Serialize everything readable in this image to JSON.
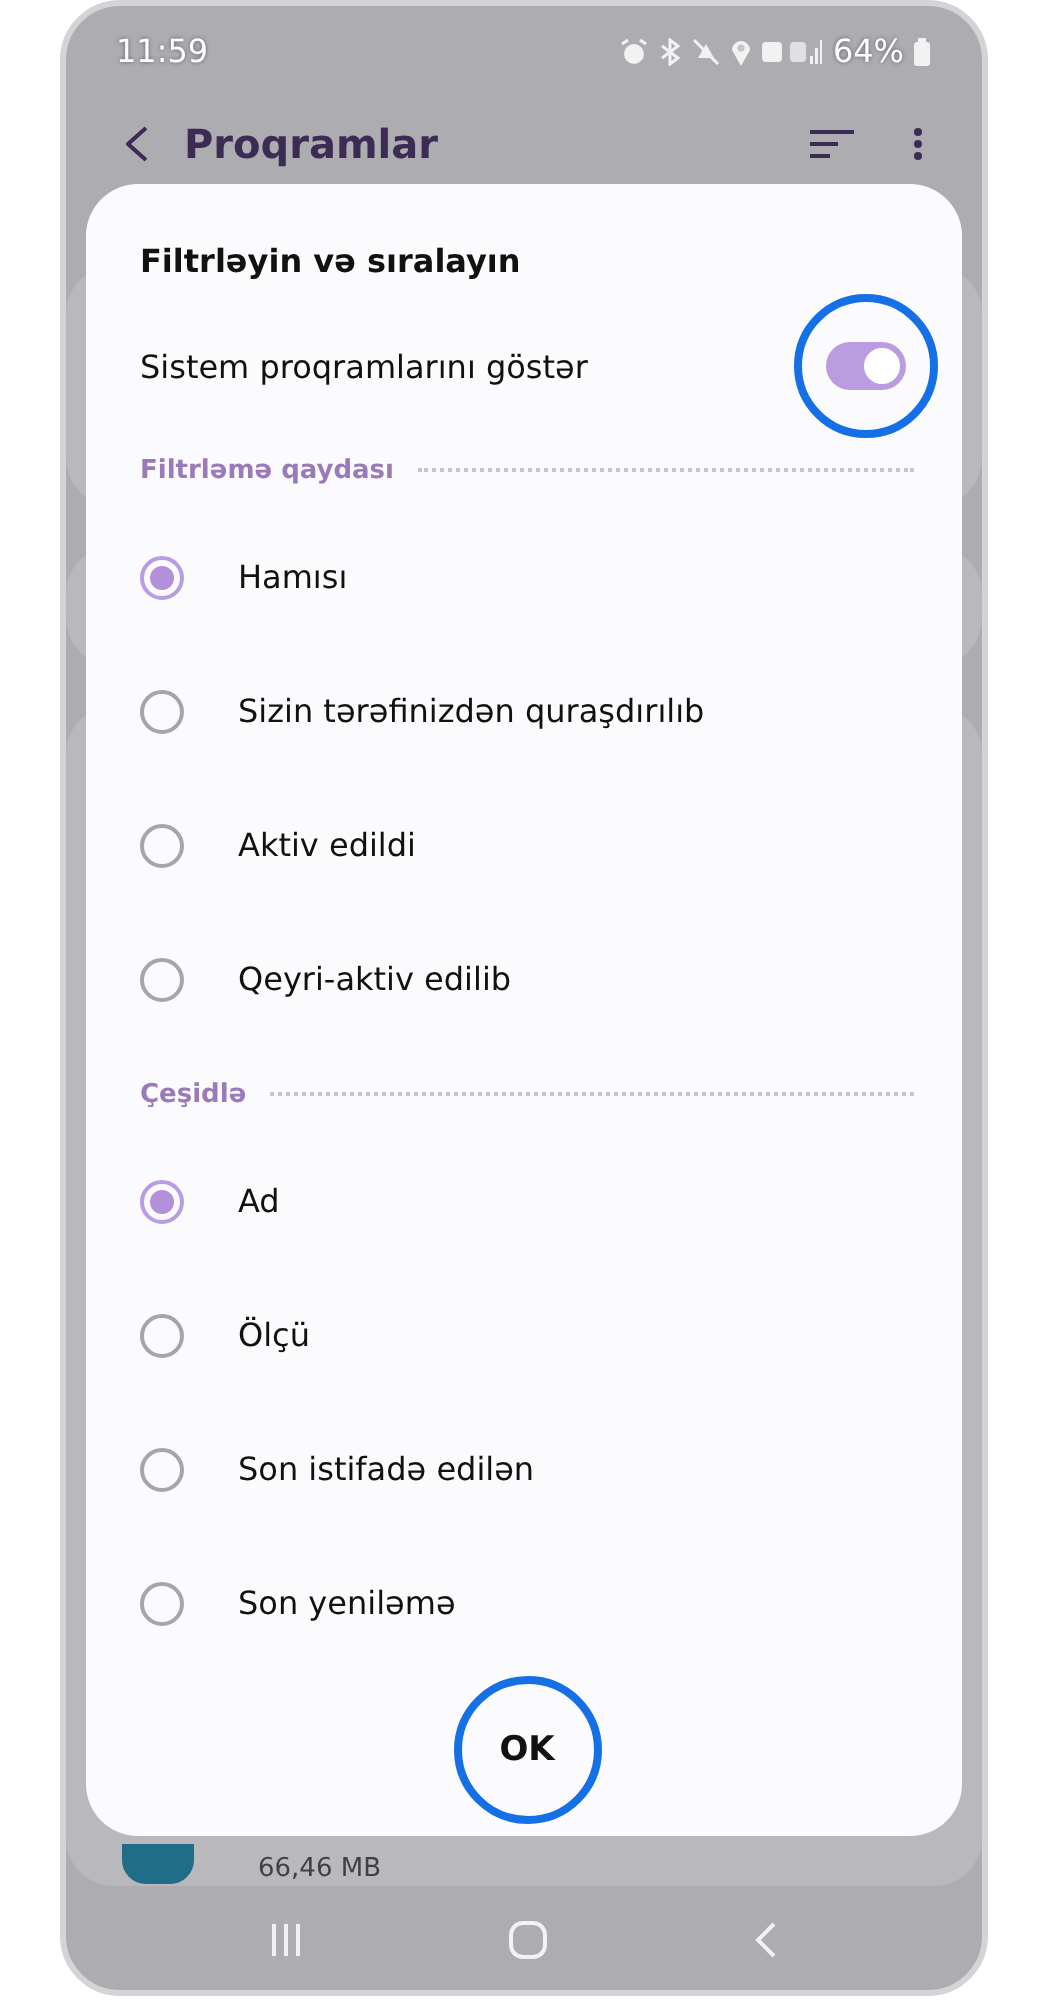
{
  "status_bar": {
    "time": "11:59",
    "battery": "64%"
  },
  "background": {
    "title": "Proqramlar",
    "item_size": "66,46 MB"
  },
  "dialog": {
    "title": "Filtrləyin və sıralayın",
    "toggle": {
      "label": "Sistem proqramlarını göstər",
      "on": true,
      "highlighted": true
    },
    "sections": [
      {
        "heading": "Filtrləmə qaydası",
        "options": [
          {
            "label": "Hamısı",
            "selected": true
          },
          {
            "label": "Sizin tərəfinizdən quraşdırılıb",
            "selected": false
          },
          {
            "label": "Aktiv edildi",
            "selected": false
          },
          {
            "label": "Qeyri-aktiv edilib",
            "selected": false
          }
        ]
      },
      {
        "heading": "Çeşidlə",
        "options": [
          {
            "label": "Ad",
            "selected": true
          },
          {
            "label": "Ölçü",
            "selected": false
          },
          {
            "label": "Son istifadə edilən",
            "selected": false
          },
          {
            "label": "Son yeniləmə",
            "selected": false
          }
        ]
      }
    ],
    "ok_button": {
      "label": "OK",
      "highlighted": true
    }
  }
}
